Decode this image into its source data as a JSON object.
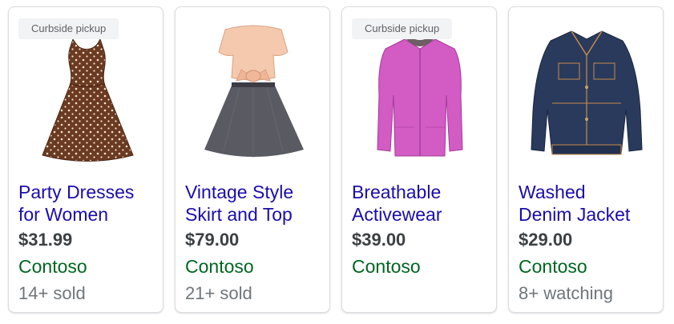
{
  "products": [
    {
      "badge": "Curbside pickup",
      "image": "brown-polka-dot-dress",
      "title_line1": "Party Dresses",
      "title_line2": "for Women",
      "price": "$31.99",
      "merchant": "Contoso",
      "meta": "14+ sold"
    },
    {
      "badge": "",
      "image": "peach-top-grey-tulle-skirt",
      "title_line1": "Vintage Style",
      "title_line2": "Skirt and Top",
      "price": "$79.00",
      "merchant": "Contoso",
      "meta": "21+ sold"
    },
    {
      "badge": "Curbside pickup",
      "image": "pink-fleece-jacket",
      "title_line1": "Breathable",
      "title_line2": "Activewear",
      "price": "$39.00",
      "merchant": "Contoso",
      "meta": ""
    },
    {
      "badge": "",
      "image": "denim-jacket",
      "title_line1": "Washed",
      "title_line2": "Denim Jacket",
      "price": "$29.00",
      "merchant": "Contoso",
      "meta": "8+ watching"
    }
  ],
  "colors": {
    "title_link": "#1a0dab",
    "merchant": "#006621",
    "price": "#3c4043",
    "meta": "#70757a",
    "badge_bg": "#f1f3f4"
  }
}
